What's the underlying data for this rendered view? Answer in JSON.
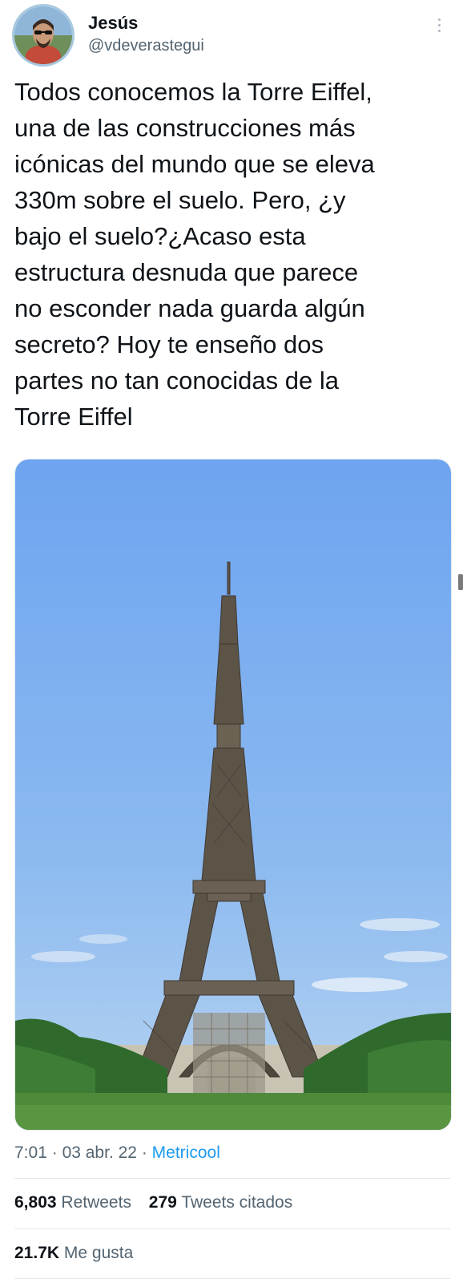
{
  "author": {
    "display_name": "Jesús",
    "handle": "@vdeverastegui"
  },
  "tweet": {
    "text": "Todos conocemos la Torre Eiffel,\nuna de las construcciones más\nicónicas del mundo que se eleva\n330m sobre el suelo. Pero, ¿y\nbajo el suelo?¿Acaso esta\nestructura desnuda que parece\nno esconder nada guarda algún\nsecreto? Hoy te enseño dos\npartes no tan conocidas de la\nTorre Eiffel"
  },
  "media": {
    "subject": "eiffel-tower-photo"
  },
  "meta": {
    "time": "7:01",
    "separator": "·",
    "date": "03 abr. 22",
    "source": "Metricool"
  },
  "stats": {
    "retweets_count": "6,803",
    "retweets_label": "Retweets",
    "quotes_count": "279",
    "quotes_label": "Tweets citados",
    "likes_count": "21.7K",
    "likes_label": "Me gusta"
  },
  "colors": {
    "link": "#1d9bf0",
    "secondary_text": "#536471",
    "sky": "#7aaef2"
  }
}
